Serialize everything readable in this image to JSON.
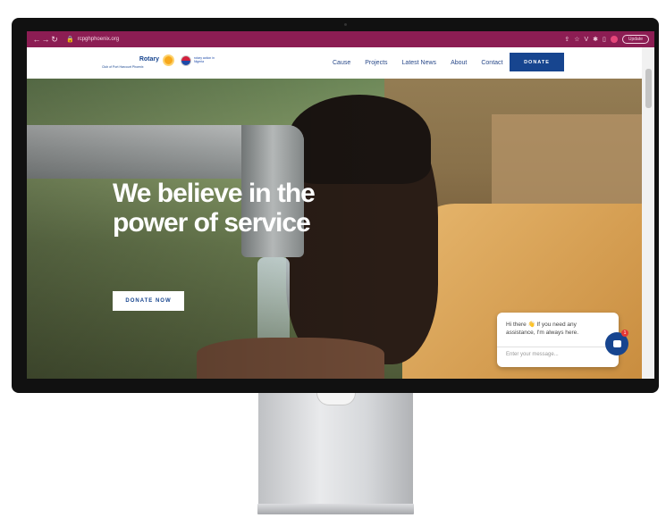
{
  "browser": {
    "url": "rcpghphoenix.org",
    "update_label": "Update",
    "back_icon": "arrow-left-icon",
    "forward_icon": "arrow-right-icon",
    "reload_icon": "reload-icon"
  },
  "site": {
    "logo_text": "Rotary",
    "logo_sub": "Club of Port Harcourt Phoenix",
    "partner_text": "rotary action in Nigeria",
    "nav": [
      "Cause",
      "Projects",
      "Latest News",
      "About",
      "Contact"
    ],
    "donate_label": "DONATE"
  },
  "hero": {
    "headline": "We believe in the power of service",
    "cta_label": "DONATE NOW"
  },
  "chat": {
    "message": "Hi there 👋 If you need any assistance, I'm always here.",
    "placeholder": "Enter your message...",
    "badge": "1"
  },
  "colors": {
    "browser_bar": "#8c1d53",
    "brand_blue": "#17458f"
  }
}
